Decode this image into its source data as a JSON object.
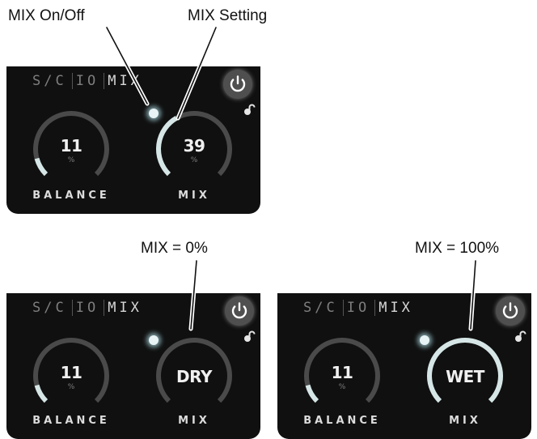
{
  "callouts": {
    "mix_on_off": "MIX On/Off",
    "mix_setting": "MIX Setting",
    "mix_zero": "MIX = 0%",
    "mix_hundred": "MIX = 100%"
  },
  "colors": {
    "panel_bg": "#101010",
    "arc_track": "#4a4a4a",
    "arc_fill": "#d6e6e6",
    "led": "#e8f3f5"
  },
  "icons": {
    "power": "power-icon",
    "lock": "unlock-icon",
    "led": "mix-enable-led"
  },
  "panels": [
    {
      "tabs": [
        "S/C",
        "IO",
        "MIX"
      ],
      "active_tab": "MIX",
      "balance": {
        "value": "11",
        "unit": "%",
        "label": "BALANCE",
        "level": 0.11
      },
      "mix": {
        "value": "39",
        "unit": "%",
        "label": "MIX",
        "level": 0.39
      }
    },
    {
      "tabs": [
        "S/C",
        "IO",
        "MIX"
      ],
      "active_tab": "MIX",
      "balance": {
        "value": "11",
        "unit": "%",
        "label": "BALANCE",
        "level": 0.11
      },
      "mix": {
        "value": "DRY",
        "unit": "",
        "label": "MIX",
        "level": 0.0
      }
    },
    {
      "tabs": [
        "S/C",
        "IO",
        "MIX"
      ],
      "active_tab": "MIX",
      "balance": {
        "value": "11",
        "unit": "%",
        "label": "BALANCE",
        "level": 0.11
      },
      "mix": {
        "value": "WET",
        "unit": "",
        "label": "MIX",
        "level": 1.0
      }
    }
  ]
}
